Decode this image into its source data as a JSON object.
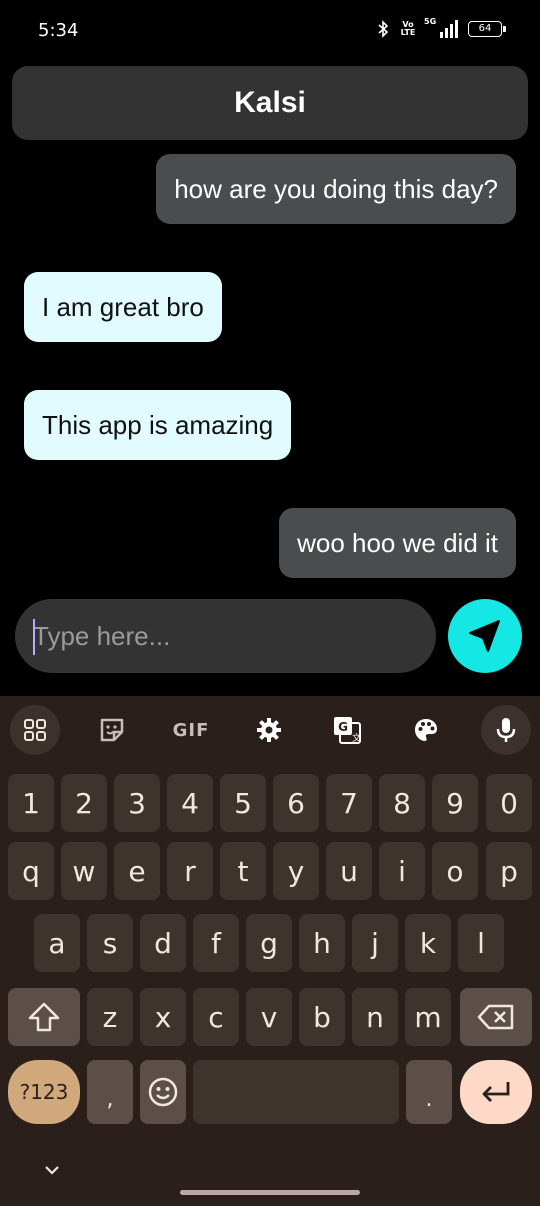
{
  "status_bar": {
    "time": "5:34",
    "volte_label": "Vo LTE",
    "network_label": "5G",
    "battery": "64"
  },
  "chat": {
    "title": "Kalsi",
    "messages": [
      {
        "side": "sent",
        "text": "how are you doing this day?"
      },
      {
        "side": "recv",
        "text": "I am great bro"
      },
      {
        "side": "recv",
        "text": "This app is amazing"
      },
      {
        "side": "sent",
        "text": "woo hoo we did it"
      }
    ]
  },
  "composer": {
    "placeholder": "Type here...",
    "value": "",
    "send_icon": "send-icon"
  },
  "keyboard": {
    "toolbar": {
      "icons": [
        "apps-grid-icon",
        "sticker-icon",
        "gif-icon",
        "settings-gear-icon",
        "translate-icon",
        "palette-icon",
        "microphone-icon"
      ],
      "gif_label": "GIF"
    },
    "row_numbers": [
      "1",
      "2",
      "3",
      "4",
      "5",
      "6",
      "7",
      "8",
      "9",
      "0"
    ],
    "row_1": [
      "q",
      "w",
      "e",
      "r",
      "t",
      "y",
      "u",
      "i",
      "o",
      "p"
    ],
    "row_2": [
      "a",
      "s",
      "d",
      "f",
      "g",
      "h",
      "j",
      "k",
      "l"
    ],
    "row_3": [
      "z",
      "x",
      "c",
      "v",
      "b",
      "n",
      "m"
    ],
    "symbols_label": "?123",
    "comma": ",",
    "period": "."
  },
  "colors": {
    "sent_bubble": "#4a4c4d",
    "received_bubble": "#e2fbff",
    "send_button": "#14e7e4",
    "keyboard_bg": "#2a1f1a"
  }
}
